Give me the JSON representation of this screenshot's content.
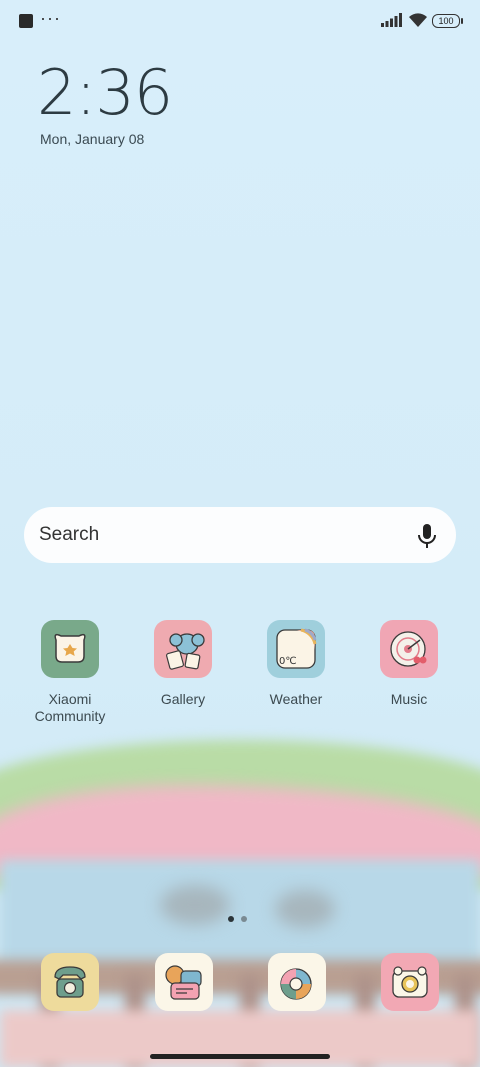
{
  "status_bar": {
    "more_indicator": "···",
    "battery": "100"
  },
  "clock": {
    "time": "2:36",
    "date": "Mon, January 08"
  },
  "search": {
    "placeholder": "Search"
  },
  "apps": [
    {
      "label": "Xiaomi\nCommunity",
      "icon": "community-icon",
      "color": "#79a98a"
    },
    {
      "label": "Gallery",
      "icon": "gallery-icon",
      "color": "#efaab0"
    },
    {
      "label": "Weather",
      "icon": "weather-icon",
      "color": "#9fcfdc",
      "icon_text": "0℃"
    },
    {
      "label": "Music",
      "icon": "music-icon",
      "color": "#f0a6b4"
    }
  ],
  "dock": [
    {
      "icon": "phone-icon",
      "color": "#eedb9c"
    },
    {
      "icon": "messages-icon",
      "color": "#fbf6e8"
    },
    {
      "icon": "browser-icon",
      "color": "#fbf6e8"
    },
    {
      "icon": "camera-icon",
      "color": "#f2a8b4"
    }
  ],
  "pages": {
    "total": 2,
    "current": 1
  }
}
